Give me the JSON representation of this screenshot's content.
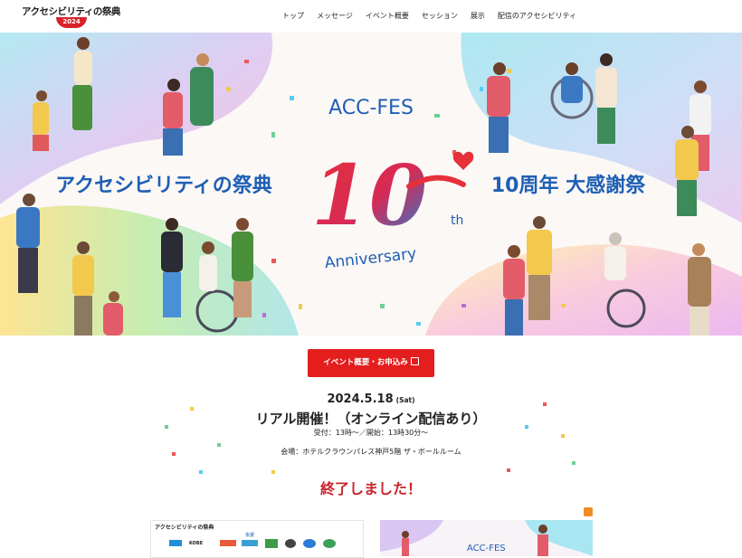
{
  "header": {
    "logo_text": "アクセシビリティの祭典",
    "logo_year": "2024",
    "nav": [
      "トップ",
      "メッセージ",
      "イベント概要",
      "セッション",
      "展示",
      "配信のアクセシビリティ"
    ]
  },
  "hero": {
    "acc_fes": "ACC-FES",
    "left_title": "アクセシビリティの祭典",
    "right_title": "10周年 大感謝祭",
    "ten": "10",
    "th": "th",
    "anniversary": "Anniversary"
  },
  "cta": {
    "label": "イベント概要・お申込み"
  },
  "event": {
    "date": "2024.5.18",
    "day": "(Sat)",
    "mode": "リアル開催！（オンライン配信あり）",
    "times": "受付：13時〜／開始：13時30分〜",
    "venue": "会場：ホテルクラウンパレス神戸5階 ザ・ボールルーム"
  },
  "status": "終了しました！",
  "thumbs": {
    "thumb1_logo": "アクセシビリティの祭典",
    "thumb1_sponsor_label": "後援",
    "thumb1_kobe": "KOBE",
    "thumb2_title": "ACC-FES"
  },
  "colors": {
    "accent": "#e41d1d",
    "status": "#c8242b",
    "blue": "#1f5fb4",
    "red": "#d8232a"
  }
}
